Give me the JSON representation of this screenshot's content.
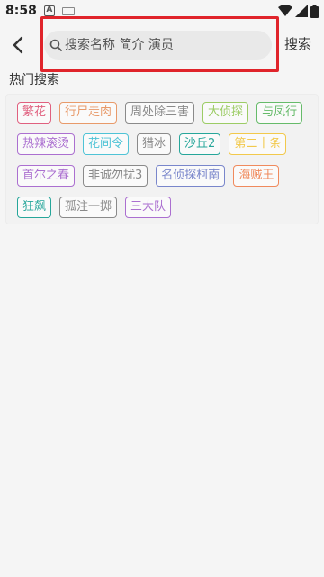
{
  "status_bar": {
    "time": "8:58",
    "a_label": "A"
  },
  "header": {
    "search_placeholder": "搜索名称 简介 演员",
    "search_button": "搜索"
  },
  "hot_search": {
    "title": "热门搜索",
    "tags": [
      {
        "label": "繁花",
        "color": "#e0607f"
      },
      {
        "label": "行尸走肉",
        "color": "#e89a6a"
      },
      {
        "label": "周处除三害",
        "color": "#8a8a8a"
      },
      {
        "label": "大侦探",
        "color": "#9ccc65"
      },
      {
        "label": "与凤行",
        "color": "#66bb6a"
      },
      {
        "label": "热辣滚烫",
        "color": "#ab6fd0"
      },
      {
        "label": "花间令",
        "color": "#4fc3d6"
      },
      {
        "label": "猎冰",
        "color": "#8a8a8a"
      },
      {
        "label": "沙丘2",
        "color": "#26a69a"
      },
      {
        "label": "第二十条",
        "color": "#f2c94c"
      },
      {
        "label": "首尔之春",
        "color": "#ab6fd0"
      },
      {
        "label": "非诚勿扰3",
        "color": "#8a8a8a"
      },
      {
        "label": "名侦探柯南",
        "color": "#7986cb"
      },
      {
        "label": "海贼王",
        "color": "#f08a5d"
      },
      {
        "label": "狂飙",
        "color": "#26a69a"
      },
      {
        "label": "孤注一掷",
        "color": "#8a8a8a"
      },
      {
        "label": "三大队",
        "color": "#ab6fd0"
      }
    ]
  }
}
